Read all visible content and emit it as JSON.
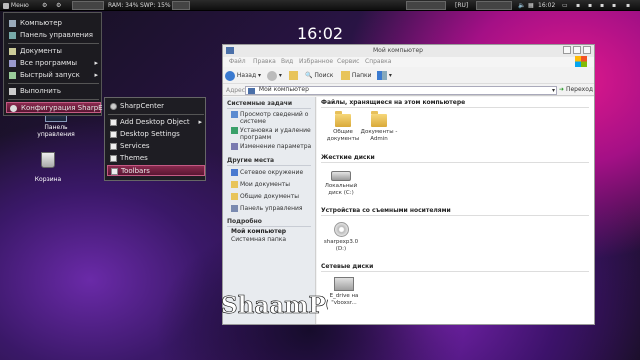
{
  "top_panel": {
    "menu_label": "Меню",
    "ram": "RAM: 34%",
    "swp": "SWP: 15%",
    "language": "[RU]",
    "time": "16:02"
  },
  "desktop_clock": "16:02",
  "start_menu": {
    "items": [
      {
        "label": "Компьютер",
        "icon": "computer-icon"
      },
      {
        "label": "Панель управления",
        "icon": "control-panel-icon"
      },
      {
        "label": "Документы",
        "icon": "documents-icon"
      },
      {
        "label": "Все программы",
        "icon": "programs-icon",
        "arrow": "▸"
      },
      {
        "label": "Быстрый запуск",
        "icon": "quick-launch-icon",
        "arrow": "▸"
      },
      {
        "label": "Выполнить",
        "icon": "run-icon"
      },
      {
        "label": "Конфигурация SharpE",
        "icon": "config-icon",
        "selected": true
      }
    ]
  },
  "submenu": {
    "items": [
      {
        "label": "SharpCenter",
        "icon": "sharpcenter-icon"
      },
      {
        "label": "Add Desktop Object",
        "arrow": "▸"
      },
      {
        "label": "Desktop Settings"
      },
      {
        "label": "Services"
      },
      {
        "label": "Themes"
      },
      {
        "label": "Toolbars",
        "selected": true
      }
    ]
  },
  "desktop_icons": [
    {
      "label": "Панель управления",
      "icon": "control-panel-icon"
    },
    {
      "label": "Корзина",
      "icon": "recycle-bin-icon"
    }
  ],
  "explorer": {
    "title": "Мой компьютер",
    "menu": [
      "Файл",
      "Правка",
      "Вид",
      "Избранное",
      "Сервис",
      "Справка"
    ],
    "toolbar": {
      "back": "Назад",
      "search": "Поиск",
      "folders": "Папки"
    },
    "address_label": "Адрес:",
    "address_value": "Мой компьютер",
    "go_label": "Переход",
    "left_pane": {
      "system_tasks_header": "Системные задачи",
      "system_tasks": [
        "Просмотр сведений о системе",
        "Установка и удаление программ",
        "Изменение параметра"
      ],
      "other_places_header": "Другие места",
      "other_places": [
        "Сетевое окружение",
        "Мои документы",
        "Общие документы",
        "Панель управления"
      ],
      "details_header": "Подробно",
      "details_title": "Мой компьютер",
      "details_subtitle": "Системная папка"
    },
    "sections": {
      "stored_files": "Файлы, хранящиеся на этом компьютере",
      "hard_disks": "Жесткие диски",
      "removable": "Устройства со съемными носителями",
      "network": "Сетевые диски"
    },
    "items": {
      "shared_docs": "Общие документы",
      "admin_docs": "Документы - Admin",
      "local_disk": "Локальный диск (C:)",
      "cd_drive": "sharpexp3.0 (D:)",
      "net_drive": "E_drive на \"vboxsr..."
    }
  },
  "watermark": "ShaamPC",
  "colors": {
    "accent_selected": "#8a2a4e",
    "panel_bg": "#1a1a1a",
    "window_bg": "#f3f3f3"
  }
}
